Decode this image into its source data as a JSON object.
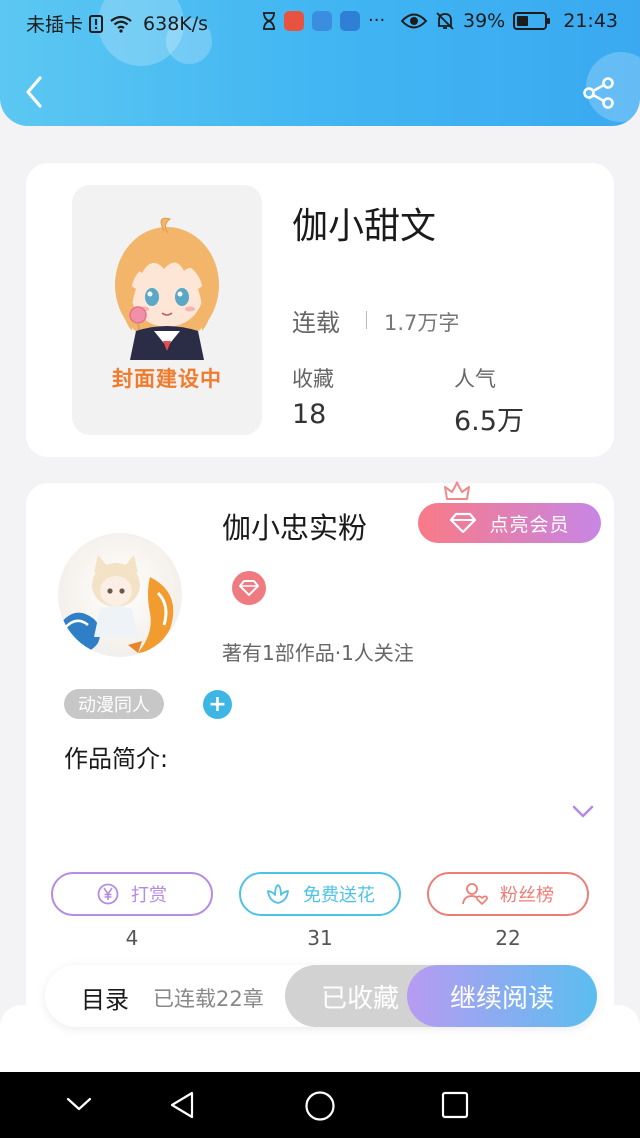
{
  "status_bar": {
    "carrier": "未插卡",
    "speed": "638K/s",
    "battery": "39%",
    "time": "21:43"
  },
  "book": {
    "cover_text": "封面建设中",
    "title": "伽小甜文",
    "status": "连载",
    "words": "1.7万字",
    "stats": [
      {
        "label": "收藏",
        "value": "18"
      },
      {
        "label": "人气",
        "value": "6.5万"
      }
    ]
  },
  "author": {
    "name": "伽小忠实粉",
    "vip_button": "点亮会员",
    "meta": "著有1部作品·1人关注",
    "tag": "动漫同人",
    "intro_label": "作品简介:"
  },
  "actions": [
    {
      "label": "打赏",
      "count": "4",
      "color": "#b58be3",
      "icon": "yen-icon"
    },
    {
      "label": "免费送花",
      "count": "31",
      "color": "#4fc3e6",
      "icon": "flower-icon"
    },
    {
      "label": "粉丝榜",
      "count": "22",
      "color": "#ee7d78",
      "icon": "fan-user-icon"
    }
  ],
  "bottom_bar": {
    "toc": "目录",
    "chapters": "已连载22章",
    "collected": "已收藏",
    "continue": "继续阅读"
  }
}
